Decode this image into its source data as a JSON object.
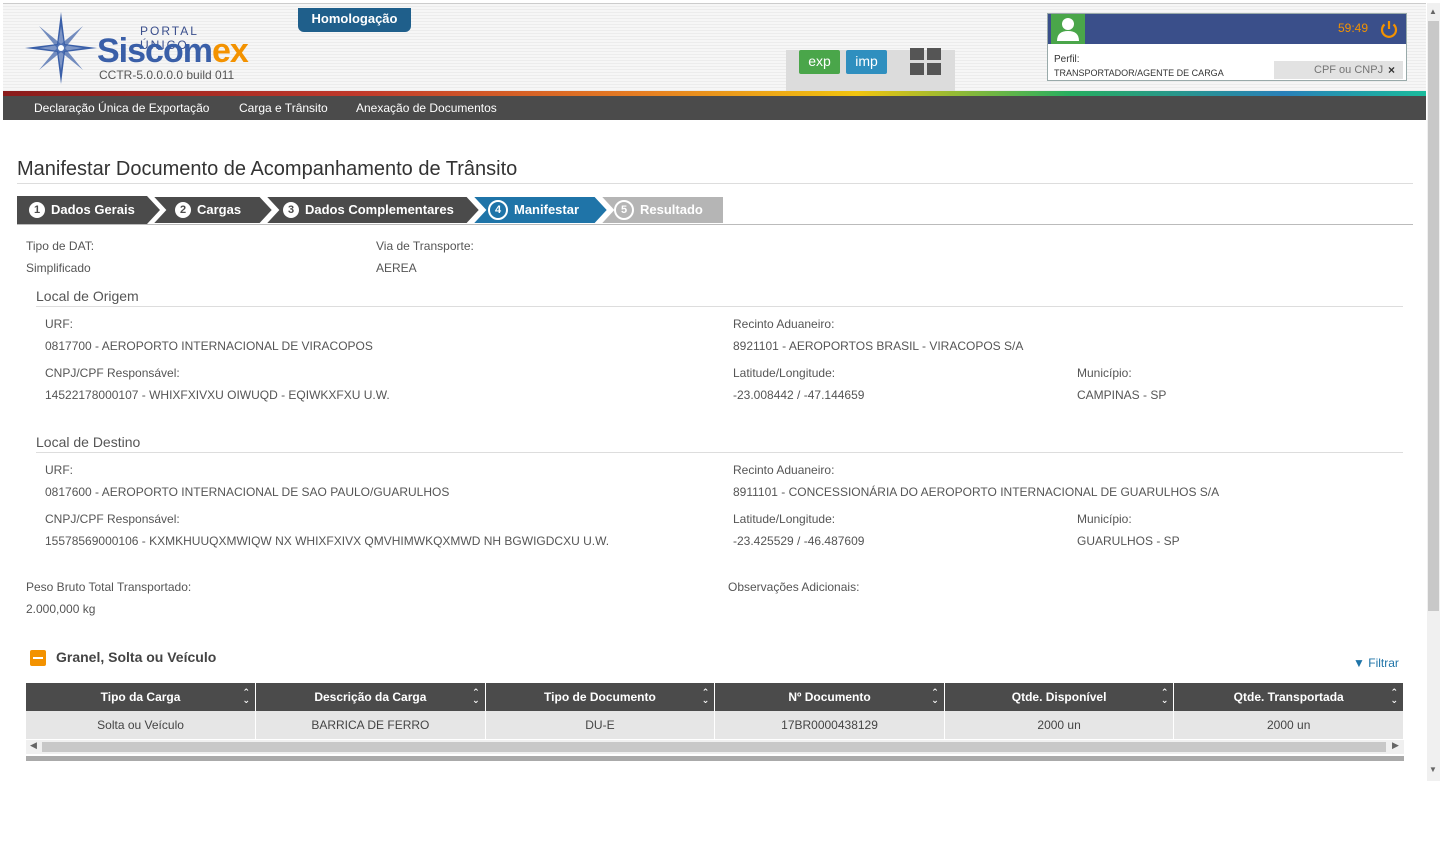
{
  "header": {
    "portal_label": "PORTAL ÚNICO",
    "brand_main": "Siscom",
    "brand_accent": "ex",
    "build": "CCTR-5.0.0.0.0  build 011",
    "environment": "Homologação",
    "sys_exp": "exp",
    "sys_imp": "imp"
  },
  "user": {
    "timer": "59:49",
    "perfil_label": "Perfil:",
    "perfil_value": "TRANSPORTADOR/AGENTE DE CARGA",
    "cpf_placeholder": "CPF ou CNPJ",
    "cpf_clear": "×"
  },
  "menu": {
    "items": [
      "Declaração Única de Exportação",
      "Carga e Trânsito",
      "Anexação de Documentos"
    ]
  },
  "page": {
    "title": "Manifestar Documento de Acompanhamento de Trânsito"
  },
  "wizard": {
    "steps": [
      {
        "num": "1",
        "label": "Dados Gerais"
      },
      {
        "num": "2",
        "label": "Cargas"
      },
      {
        "num": "3",
        "label": "Dados Complementares"
      },
      {
        "num": "4",
        "label": "Manifestar"
      },
      {
        "num": "5",
        "label": "Resultado"
      }
    ],
    "active_step": "4"
  },
  "dat": {
    "tipo_label": "Tipo de DAT:",
    "tipo_value": "Simplificado",
    "via_label": "Via de Transporte:",
    "via_value": "AEREA"
  },
  "origem": {
    "title": "Local de Origem",
    "urf_label": "URF:",
    "urf_value": "0817700 - AEROPORTO INTERNACIONAL DE VIRACOPOS",
    "recinto_label": "Recinto Aduaneiro:",
    "recinto_value": "8921101 - AEROPORTOS BRASIL - VIRACOPOS S/A",
    "cnpj_label": "CNPJ/CPF Responsável:",
    "cnpj_value": "14522178000107 - WHIXFXIVXU OIWUQD - EQIWKXFXU U.W.",
    "latlon_label": "Latitude/Longitude:",
    "latlon_value": "-23.008442 / -47.144659",
    "municipio_label": "Município:",
    "municipio_value": "CAMPINAS - SP"
  },
  "destino": {
    "title": "Local de Destino",
    "urf_label": "URF:",
    "urf_value": "0817600 - AEROPORTO INTERNACIONAL DE SAO PAULO/GUARULHOS",
    "recinto_label": "Recinto Aduaneiro:",
    "recinto_value": "8911101 - CONCESSIONÁRIA DO AEROPORTO INTERNACIONAL DE GUARULHOS S/A",
    "cnpj_label": "CNPJ/CPF Responsável:",
    "cnpj_value": "15578569000106 - KXMKHUUQXMWIQW NX WHIXFXIVX QMVHIMWKQXMWD NH BGWIGDCXU U.W.",
    "latlon_label": "Latitude/Longitude:",
    "latlon_value": "-23.425529 / -46.487609",
    "municipio_label": "Município:",
    "municipio_value": "GUARULHOS - SP"
  },
  "totals": {
    "peso_label": "Peso Bruto Total Transportado:",
    "peso_value": "2.000,000 kg",
    "obs_label": "Observações Adicionais:"
  },
  "carga_panel": {
    "title": "Granel, Solta ou Veículo",
    "filter_label": "Filtrar",
    "columns": [
      "Tipo da Carga",
      "Descrição da Carga",
      "Tipo de Documento",
      "Nº Documento",
      "Qtde. Disponível",
      "Qtde. Transportada"
    ],
    "rows": [
      [
        "Solta ou Veículo",
        "BARRICA DE FERRO",
        "DU-E",
        "17BR0000438129",
        "2000 un",
        "2000 un"
      ]
    ]
  },
  "colors": {
    "menu_bg": "#4b4b4b",
    "active_step": "#1f74a8",
    "accent": "#f39200",
    "brand": "#3a5fa8"
  }
}
